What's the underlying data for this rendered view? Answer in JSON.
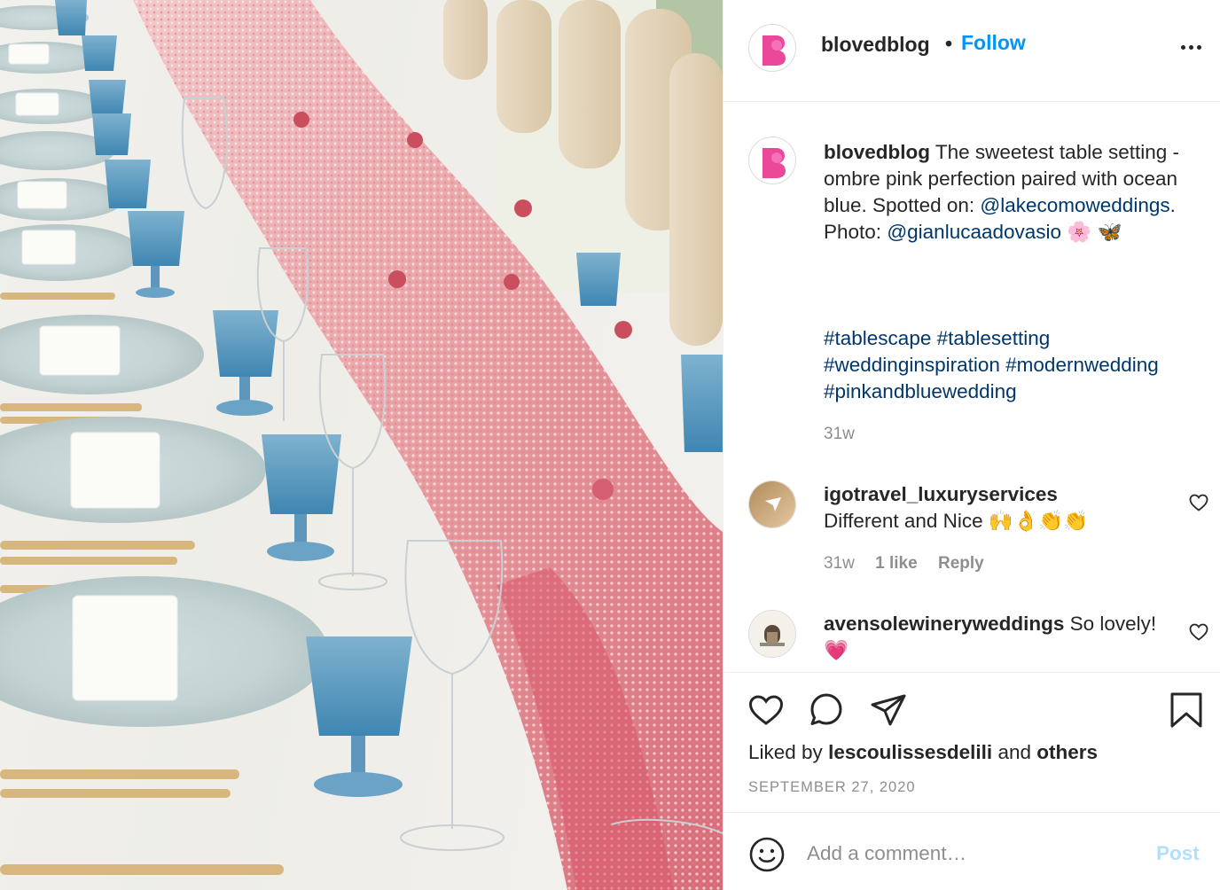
{
  "post": {
    "username": "blovedblog",
    "dot": "•",
    "follow_label": "Follow",
    "avatar_letter": "B",
    "brand_color": "#ec4899"
  },
  "caption": {
    "username": "blovedblog",
    "text_1": "The sweetest table setting - ombre pink perfection paired with ocean blue. Spotted on: ",
    "mention_1": "@lakecomoweddings",
    "text_2": ". Photo: ",
    "mention_2": "@gianlucaadovasio",
    "emoji_1": "🌸",
    "emoji_2": "🦋",
    "hashtags": [
      "#tablescape",
      "#tablesetting",
      "#weddinginspiration",
      "#modernwedding",
      "#pinkandbluewedding"
    ],
    "time": "31w"
  },
  "comments": [
    {
      "username": "igotravel_luxuryservices",
      "text": "Different and Nice 🙌👌👏👏",
      "time": "31w",
      "likes": "1 like",
      "reply_label": "Reply"
    },
    {
      "username": "avensolewineryweddings",
      "text": "So lovely! 💗"
    }
  ],
  "actions": {
    "liked_by_prefix": "Liked by",
    "liked_by_user": "lescoulissesdelili",
    "and_label": "and",
    "others_label": "others",
    "date": "SEPTEMBER 27, 2020"
  },
  "add_comment": {
    "placeholder": "Add a comment…",
    "post_label": "Post"
  },
  "icons": {
    "like": "heart-icon",
    "comment": "comment-bubble-icon",
    "share": "paper-plane-icon",
    "save": "bookmark-icon",
    "more": "more-options-icon",
    "emoji": "smiley-icon"
  },
  "colors": {
    "link": "#00376b",
    "follow": "#0095f6",
    "muted": "#8e8e8e",
    "post_disabled": "#b2dffc"
  }
}
